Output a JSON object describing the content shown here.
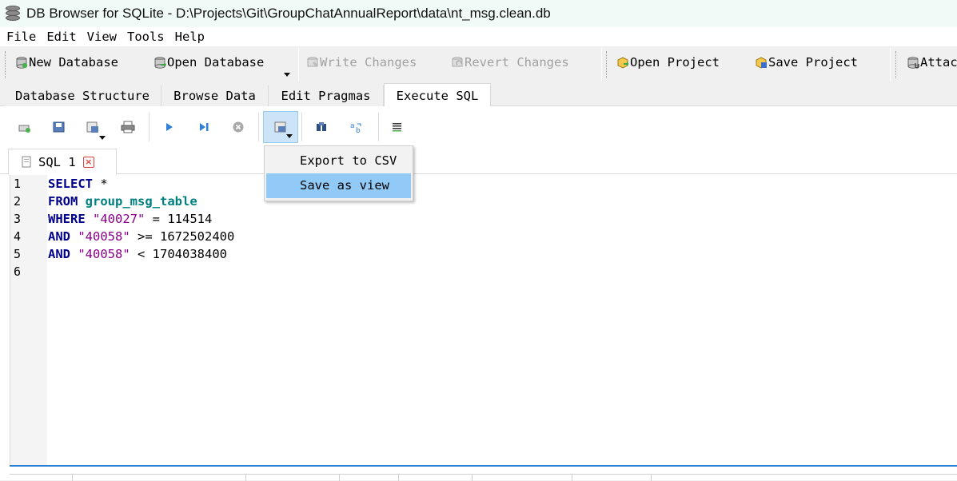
{
  "window": {
    "title": "DB Browser for SQLite - D:\\Projects\\Git\\GroupChatAnnualReport\\data\\nt_msg.clean.db"
  },
  "menubar": {
    "items": [
      "File",
      "Edit",
      "View",
      "Tools",
      "Help"
    ]
  },
  "toolbar": {
    "new_database": "New Database",
    "open_database": "Open Database",
    "write_changes": "Write Changes",
    "revert_changes": "Revert Changes",
    "open_project": "Open Project",
    "save_project": "Save Project",
    "attach": "Attac"
  },
  "tabs": [
    "Database Structure",
    "Browse Data",
    "Edit Pragmas",
    "Execute SQL"
  ],
  "active_tab": "Execute SQL",
  "sql_toolbar": {
    "icons": [
      "open-tab-icon",
      "open-sql-file-icon",
      "save-sql-file-icon",
      "print-icon",
      "execute-all-icon",
      "execute-current-line-icon",
      "stop-execution-icon",
      "export-results-icon",
      "find-icon",
      "find-replace-icon",
      "comment-icon"
    ]
  },
  "editor_tab": {
    "label": "SQL 1"
  },
  "editor": {
    "line_numbers": [
      "1",
      "2",
      "3",
      "4",
      "5",
      "6"
    ],
    "lines": [
      [
        {
          "t": "kw",
          "v": "SELECT"
        },
        {
          "t": "plain",
          "v": " *"
        }
      ],
      [
        {
          "t": "kw",
          "v": "FROM"
        },
        {
          "t": "plain",
          "v": " "
        },
        {
          "t": "tbl",
          "v": "group_msg_table"
        }
      ],
      [
        {
          "t": "kw",
          "v": "WHERE"
        },
        {
          "t": "plain",
          "v": " "
        },
        {
          "t": "str",
          "v": "\"40027\""
        },
        {
          "t": "plain",
          "v": " = 114514"
        }
      ],
      [
        {
          "t": "kw",
          "v": "AND"
        },
        {
          "t": "plain",
          "v": " "
        },
        {
          "t": "str",
          "v": "\"40058\""
        },
        {
          "t": "plain",
          "v": " >= 1672502400"
        }
      ],
      [
        {
          "t": "kw",
          "v": "AND"
        },
        {
          "t": "plain",
          "v": " "
        },
        {
          "t": "str",
          "v": "\"40058\""
        },
        {
          "t": "plain",
          "v": " < 1704038400"
        }
      ],
      []
    ]
  },
  "dropdown": {
    "items": [
      "Export to CSV",
      "Save as view"
    ],
    "highlighted": "Save as view"
  },
  "colors": {
    "keyword": "#00008b",
    "table": "#008080",
    "string": "#8b008b",
    "highlight": "#91c9f7"
  }
}
